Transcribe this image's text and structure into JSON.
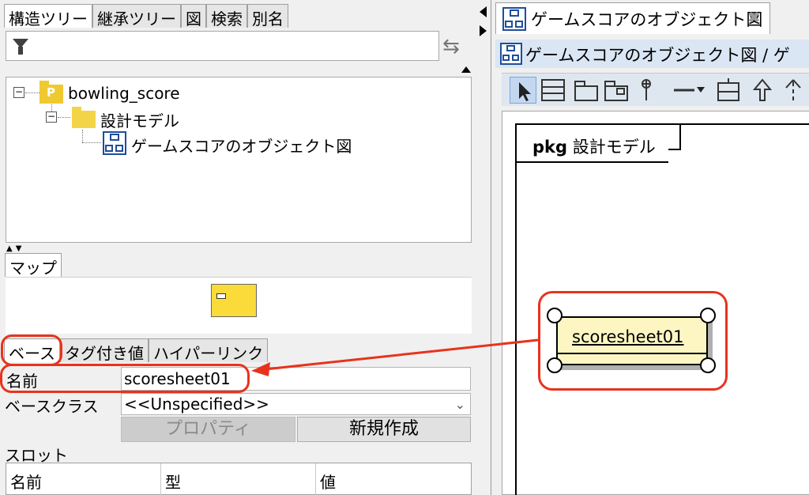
{
  "left_panel": {
    "tabs": [
      "構造ツリー",
      "継承ツリー",
      "図",
      "検索",
      "別名"
    ],
    "tree": {
      "root_label": "bowling_score",
      "root_icon_letter": "P",
      "model_label": "設計モデル",
      "diagram_label": "ゲームスコアのオブジェクト図"
    },
    "map_tab": "マップ",
    "prop_tabs": [
      "ベース",
      "タグ付き値",
      "ハイパーリンク"
    ],
    "name_label": "名前",
    "name_value": "scoresheet01",
    "baseclass_label": "ベースクラス",
    "baseclass_value": "<<Unspecified>>",
    "property_button": "プロパティ",
    "new_button": "新規作成",
    "slot_label": "スロット",
    "slot_columns": [
      "名前",
      "型",
      "値"
    ]
  },
  "right_panel": {
    "doc_tab_title": "ゲームスコアのオブジェクト図",
    "close_glyph": "✖",
    "diagram_header": "ゲームスコアのオブジェクト図 / ゲ",
    "frame_keyword": "pkg",
    "frame_name": "設計モデル",
    "object_name": "scoresheet01"
  },
  "colors": {
    "highlight": "#e8331c",
    "object_fill": "#fdf6c3",
    "package_yellow": "#f0c931",
    "diagram_blue": "#1f4e9a"
  }
}
